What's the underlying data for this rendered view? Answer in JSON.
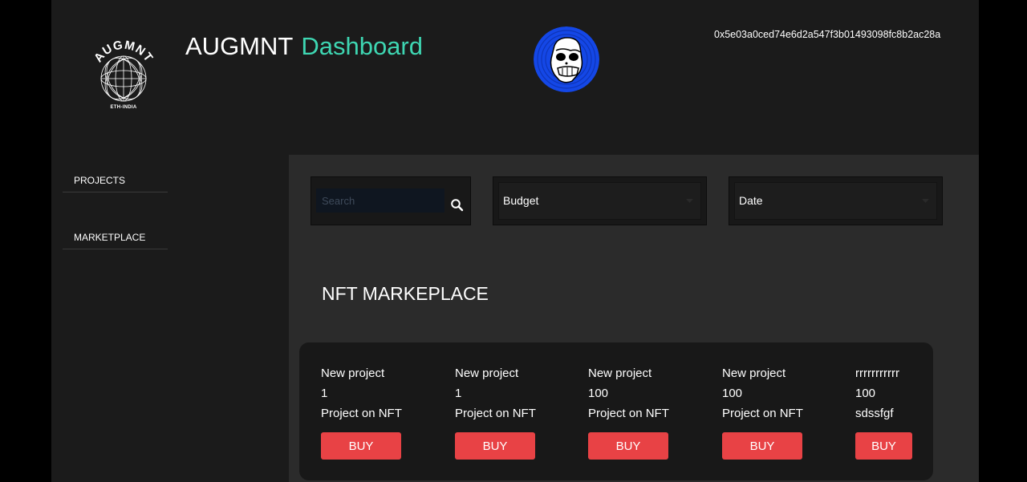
{
  "header": {
    "logo_text": "AUGMNT",
    "logo_subtext": "ETH-INDIA",
    "brand": "AUGMNT",
    "brand_accent": "Dashboard",
    "wallet_address": "0x5e03a0ced74e6d2a547f3b01493098fc8b2ac28a",
    "avatar_icon": "bored-ape-avatar-icon"
  },
  "sidebar": {
    "items": [
      {
        "label": "PROJECTS"
      },
      {
        "label": "MARKETPLACE"
      }
    ]
  },
  "filters": {
    "search_placeholder": "Search",
    "search_value": "",
    "budget_label": "Budget",
    "date_label": "Date"
  },
  "marketplace": {
    "title": "NFT MARKEPLACE",
    "cards": [
      {
        "name": "New project",
        "price": "1",
        "description": "Project on NFT",
        "buy_label": "BUY"
      },
      {
        "name": "New project",
        "price": "1",
        "description": "Project on NFT",
        "buy_label": "BUY"
      },
      {
        "name": "New project",
        "price": "100",
        "description": "Project on NFT",
        "buy_label": "BUY"
      },
      {
        "name": "New project",
        "price": "100",
        "description": "Project on NFT",
        "buy_label": "BUY"
      },
      {
        "name": "rrrrrrrrrrr",
        "price": "100",
        "description": "sdssfgf",
        "buy_label": "BUY"
      }
    ]
  },
  "colors": {
    "accent": "#3ed6b2",
    "buy": "#e84245",
    "avatar_bg": "#1447e6"
  }
}
